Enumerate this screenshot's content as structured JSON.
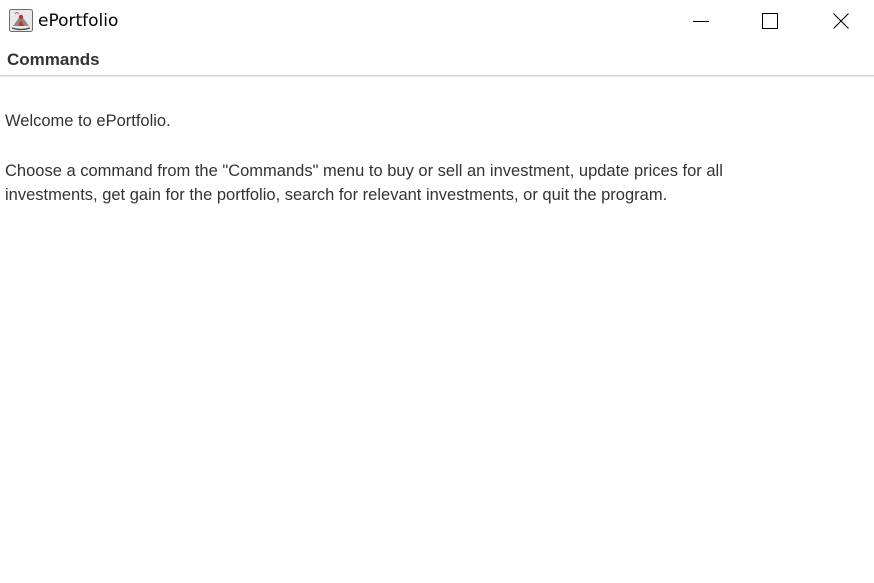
{
  "window": {
    "title": "ePortfolio",
    "icon": "java-coffee-cup-icon",
    "controls": {
      "minimize_icon": "minimize-icon",
      "maximize_icon": "maximize-icon",
      "close_icon": "close-icon"
    }
  },
  "menubar": {
    "items": [
      {
        "label": "Commands"
      }
    ]
  },
  "content": {
    "welcome": "Welcome to ePortfolio.",
    "instructions_line1": "Choose a command from the \"Commands\" menu to buy or sell an investment, update prices for all",
    "instructions_line2": "investments, get gain for the portfolio, search for relevant investments, or quit the program."
  },
  "colors": {
    "background": "#ffffff",
    "text": "#333333",
    "title_text": "#000000",
    "menubar_border": "#d6d6d6"
  }
}
